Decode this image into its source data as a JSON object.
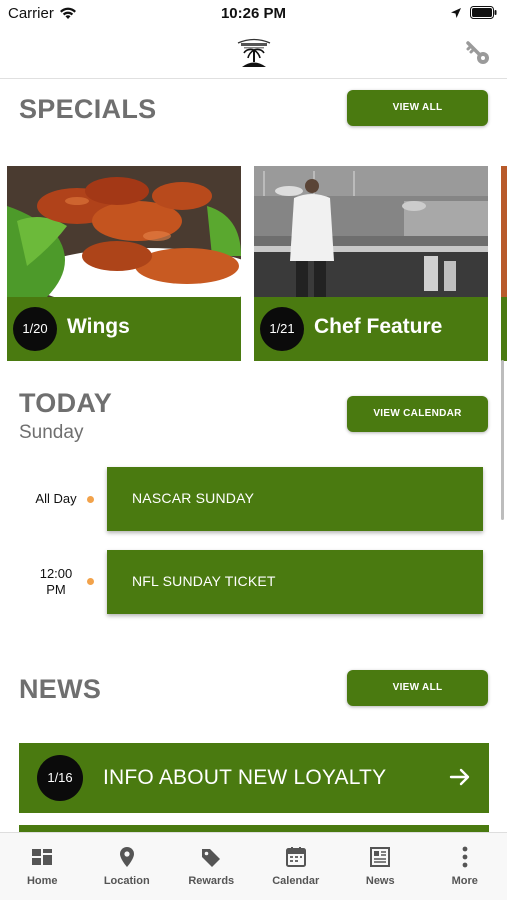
{
  "status_bar": {
    "carrier": "Carrier",
    "time": "10:26 PM"
  },
  "header": {
    "logo_icon": "restaurant-logo-icon",
    "account_icon": "key-icon"
  },
  "specials": {
    "title": "SPECIALS",
    "view_all": "VIEW ALL",
    "cards": [
      {
        "date": "1/20",
        "title": "Wings"
      },
      {
        "date": "1/21",
        "title": "Chef Feature"
      }
    ]
  },
  "today": {
    "title": "TODAY",
    "day": "Sunday",
    "view_calendar": "VIEW CALENDAR",
    "events": [
      {
        "time": "All Day",
        "title": "NASCAR SUNDAY"
      },
      {
        "time_line1": "12:00",
        "time_line2": "PM",
        "title": "NFL SUNDAY TICKET"
      }
    ]
  },
  "news": {
    "title": "NEWS",
    "view_all": "VIEW ALL",
    "items": [
      {
        "date": "1/16",
        "title": "INFO ABOUT NEW LOYALTY"
      }
    ]
  },
  "tabbar": {
    "items": [
      {
        "label": "Home",
        "icon": "home-grid-icon"
      },
      {
        "label": "Location",
        "icon": "location-pin-icon"
      },
      {
        "label": "Rewards",
        "icon": "tag-icon"
      },
      {
        "label": "Calendar",
        "icon": "calendar-icon"
      },
      {
        "label": "News",
        "icon": "newspaper-icon"
      },
      {
        "label": "More",
        "icon": "more-vertical-icon"
      }
    ]
  },
  "colors": {
    "primary_green": "#4a7a10",
    "event_dot": "#f2a24a",
    "section_gray": "#6f6f6f"
  }
}
